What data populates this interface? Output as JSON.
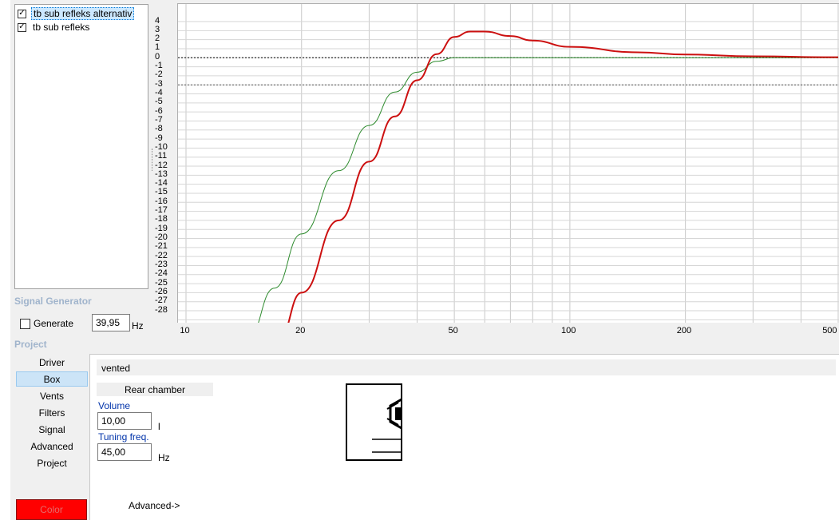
{
  "series_list": {
    "items": [
      {
        "label": "tb sub refleks alternativ",
        "checked": true,
        "selected": true
      },
      {
        "label": "tb sub refleks",
        "checked": true,
        "selected": false
      }
    ]
  },
  "signal_generator": {
    "title": "Signal Generator",
    "generate_label": "Generate",
    "generate_checked": false,
    "frequency_value": "39,95",
    "frequency_unit": "Hz"
  },
  "project": {
    "title": "Project",
    "nav": [
      "Driver",
      "Box",
      "Vents",
      "Filters",
      "Signal",
      "Advanced",
      "Project"
    ],
    "active_nav": "Box",
    "color_button": "Color"
  },
  "box_panel": {
    "box_type": "vented",
    "rear_chamber_label": "Rear chamber",
    "volume_label": "Volume",
    "volume_value": "10,00",
    "volume_unit": "l",
    "tuning_label": "Tuning freq.",
    "tuning_value": "45,00",
    "tuning_unit": "Hz",
    "advanced_link": "Advanced->"
  },
  "chart_data": {
    "type": "line",
    "x_scale": "log",
    "xlim": [
      10,
      500
    ],
    "ylim": [
      -28,
      4
    ],
    "x_ticks": [
      "10",
      "20",
      "50",
      "100",
      "200",
      "500"
    ],
    "y_ticks": [
      "4",
      "3",
      "2",
      "1",
      "0",
      "-1",
      "-2",
      "-3",
      "-4",
      "-5",
      "-6",
      "-7",
      "-8",
      "-9",
      "-10",
      "-11",
      "-12",
      "-13",
      "-14",
      "-15",
      "-16",
      "-17",
      "-18",
      "-19",
      "-20",
      "-21",
      "-22",
      "-23",
      "-24",
      "-25",
      "-26",
      "-27",
      "-28"
    ],
    "reference_lines": [
      0,
      -3
    ],
    "grid": true,
    "series": [
      {
        "color": "#2e8b2e",
        "x": [
          14.5,
          17,
          20,
          25,
          30,
          35,
          40,
          45,
          50,
          60,
          100,
          500
        ],
        "y": [
          -31,
          -25.5,
          -19.5,
          -12.5,
          -7.5,
          -3.8,
          -1.6,
          -0.4,
          0,
          0,
          0,
          0
        ]
      },
      {
        "color": "#cc1010",
        "x": [
          17.5,
          20,
          25,
          30,
          35,
          40,
          45,
          50,
          55,
          60,
          70,
          80,
          100,
          150,
          200,
          300,
          500
        ],
        "y": [
          -31,
          -26,
          -18,
          -11.5,
          -6.5,
          -2.5,
          0.4,
          2.3,
          2.9,
          2.9,
          2.4,
          1.9,
          1.2,
          0.6,
          0.35,
          0.15,
          0.05
        ]
      }
    ]
  }
}
